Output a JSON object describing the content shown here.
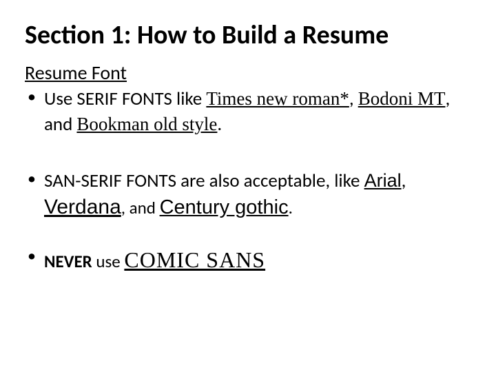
{
  "title": "Section 1: How to Build a Resume",
  "subheading": "Resume Font",
  "bullet1": {
    "lead": "Use SERIF FONTS ",
    "like": "like ",
    "font1": "Times new roman*",
    "comma1": ", ",
    "font2": "Bodoni MT",
    "comma2": ", ",
    "and": "and ",
    "font3": "Bookman old style",
    "period": "."
  },
  "bullet2": {
    "lead": "SAN-SERIF FONTS are also acceptable, like ",
    "font1": "Arial",
    "comma1": ", ",
    "font2": "Verdana",
    "comma2": ", ",
    "and": "and ",
    "font3": "Century gothic",
    "period": "."
  },
  "bullet3": {
    "never": "NEVER",
    "use": " use ",
    "font": "COMIC SANS"
  }
}
